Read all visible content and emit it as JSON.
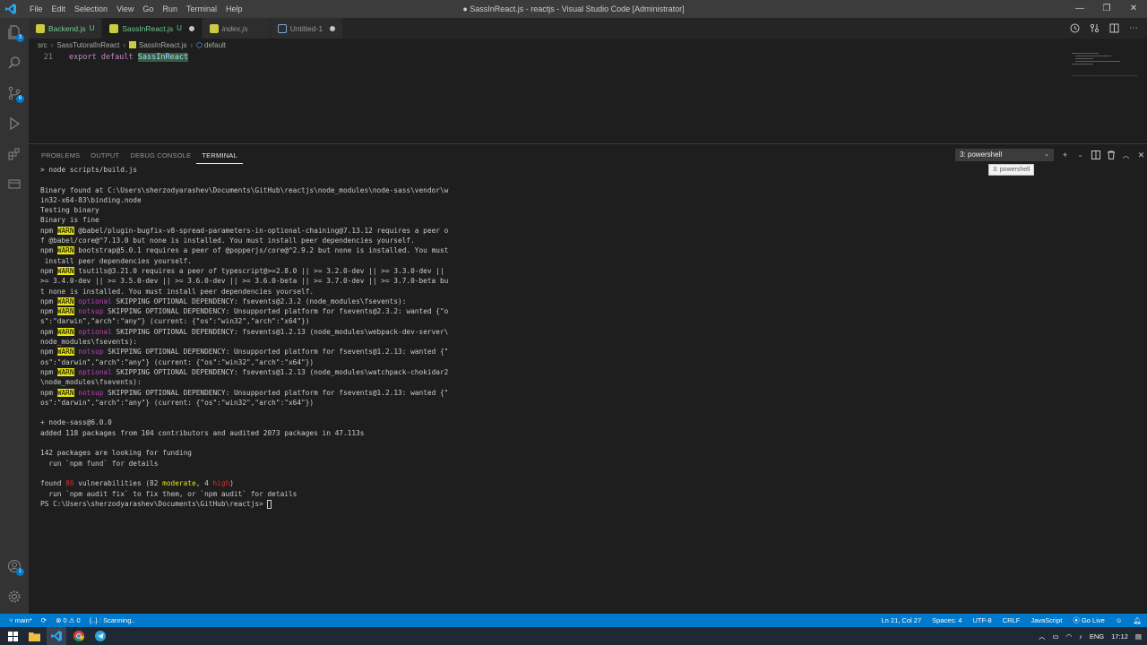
{
  "titlebar": {
    "menu": [
      "File",
      "Edit",
      "Selection",
      "View",
      "Go",
      "Run",
      "Terminal",
      "Help"
    ],
    "title": "● SassInReact.js - reactjs - Visual Studio Code [Administrator]",
    "controls": [
      "—",
      "❐",
      "✕"
    ]
  },
  "activity": {
    "explorer_badge": "3",
    "scm_badge": "6",
    "account_badge": "1"
  },
  "tabs": [
    {
      "label": "Backend.js",
      "status": "U"
    },
    {
      "label": "SassInReact.js",
      "status": "U"
    },
    {
      "label": "index.js"
    },
    {
      "label": "Untitled-1"
    }
  ],
  "breadcrumb": [
    "src",
    "SassTutoralInReact",
    "SassInReact.js",
    "default"
  ],
  "editor": {
    "line_number": "21",
    "code_keyword": "export default ",
    "code_ident": "SassInReact"
  },
  "panel": {
    "tabs": [
      "PROBLEMS",
      "OUTPUT",
      "DEBUG CONSOLE",
      "TERMINAL"
    ],
    "terminal_select": "3: powershell",
    "tooltip": "3: powershell"
  },
  "terminal": {
    "l1": "> node scripts/build.js",
    "l2": "Binary found at C:\\Users\\sherzodyarashev\\Documents\\GitHub\\reactjs\\node_modules\\node-sass\\vendor\\w",
    "l3": "in32-x64-83\\binding.node",
    "l4": "Testing binary",
    "l5": "Binary is fine",
    "npm": "npm ",
    "warn": "WARN",
    "w1a": " @babel/plugin-bugfix-v8-spread-parameters-in-optional-chaining@7.13.12 requires a peer o",
    "w1b": "f @babel/core@^7.13.0 but none is installed. You must install peer dependencies yourself.",
    "w2a": " bootstrap@5.0.1 requires a peer of @popperjs/core@^2.9.2 but none is installed. You must",
    "w2b": " install peer dependencies yourself.",
    "w3a": " tsutils@3.21.0 requires a peer of typescript@>=2.8.0 || >= 3.2.0-dev || >= 3.3.0-dev ||",
    "w3b": ">= 3.4.0-dev || >= 3.5.0-dev || >= 3.6.0-dev || >= 3.6.0-beta || >= 3.7.0-dev || >= 3.7.0-beta bu",
    "w3c": "t none is installed. You must install peer dependencies yourself.",
    "optional": "optional",
    "notsup": "notsup",
    "o1": " SKIPPING OPTIONAL DEPENDENCY: fsevents@2.3.2 (node_modules\\fsevents):",
    "n1a": " SKIPPING OPTIONAL DEPENDENCY: Unsupported platform for fsevents@2.3.2: wanted {\"o",
    "n1b": "s\":\"darwin\",\"arch\":\"any\"} (current: {\"os\":\"win32\",\"arch\":\"x64\"})",
    "o2a": " SKIPPING OPTIONAL DEPENDENCY: fsevents@1.2.13 (node_modules\\webpack-dev-server\\",
    "o2b": "node_modules\\fsevents):",
    "n2a": " SKIPPING OPTIONAL DEPENDENCY: Unsupported platform for fsevents@1.2.13: wanted {\"",
    "n2b": "os\":\"darwin\",\"arch\":\"any\"} (current: {\"os\":\"win32\",\"arch\":\"x64\"})",
    "o3a": " SKIPPING OPTIONAL DEPENDENCY: fsevents@1.2.13 (node_modules\\watchpack-chokidar2",
    "o3b": "\\node_modules\\fsevents):",
    "n3a": " SKIPPING OPTIONAL DEPENDENCY: Unsupported platform for fsevents@1.2.13: wanted {\"",
    "n3b": "os\":\"darwin\",\"arch\":\"any\"} (current: {\"os\":\"win32\",\"arch\":\"x64\"})",
    "added1": "+ node-sass@6.0.0",
    "added2": "added 118 packages from 104 contributors and audited 2073 packages in 47.113s",
    "fund1": "142 packages are looking for funding",
    "fund2": "  run `npm fund` for details",
    "vuln_pre": "found ",
    "vuln_count": "86",
    "vuln_mid1": " vulnerabilities (82 ",
    "vuln_moderate": "moderate",
    "vuln_mid2": ", 4 ",
    "vuln_high": "high",
    "vuln_end": ")",
    "audit": "  run `npm audit fix` to fix them, or `npm audit` for details",
    "prompt": "PS C:\\Users\\sherzodyarashev\\Documents\\GitHub\\reactjs> "
  },
  "statusbar": {
    "branch": "main*",
    "problems": "⊗ 0 ⚠ 0",
    "scanning": "{..} : Scanning..",
    "position": "Ln 21, Col 27",
    "spaces": "Spaces: 4",
    "encoding": "UTF-8",
    "eol": "CRLF",
    "language": "JavaScript",
    "golive": "Go Live"
  },
  "taskbar": {
    "lang": "ENG",
    "time": "17:12"
  },
  "colors": {
    "accent": "#007acc",
    "warn_bg": "#e5e510",
    "magenta": "#bc3fbc"
  }
}
